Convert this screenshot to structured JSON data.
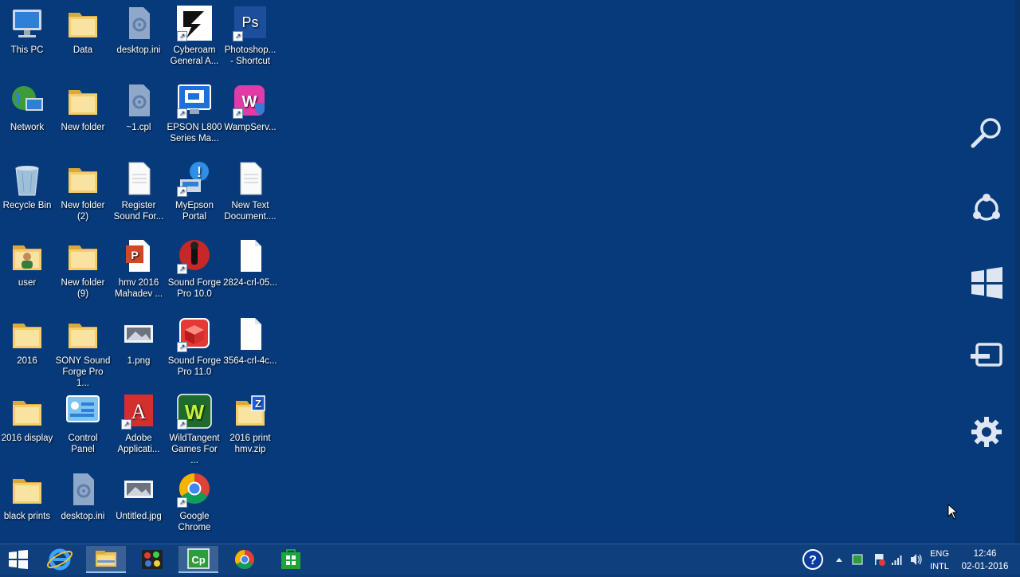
{
  "desktop_icons": [
    {
      "label": "This PC",
      "icon": "computer-icon"
    },
    {
      "label": "Data",
      "icon": "folder-icon"
    },
    {
      "label": "desktop.ini",
      "icon": "settings-file-icon"
    },
    {
      "label": "Cyberoam\nGeneral A...",
      "icon": "cyberoam-icon"
    },
    {
      "label": "Photoshop...\n- Shortcut",
      "icon": "photoshop-icon"
    },
    {
      "label": "Network",
      "icon": "network-icon"
    },
    {
      "label": "New folder",
      "icon": "folder-icon"
    },
    {
      "label": "~1.cpl",
      "icon": "settings-file-icon"
    },
    {
      "label": "EPSON L800\nSeries Ma...",
      "icon": "epson-icon"
    },
    {
      "label": "WampServ...",
      "icon": "wamp-icon"
    },
    {
      "label": "Recycle Bin",
      "icon": "recycle-bin-icon"
    },
    {
      "label": "New folder\n(2)",
      "icon": "folder-icon"
    },
    {
      "label": "Register\nSound For...",
      "icon": "document-icon"
    },
    {
      "label": "MyEpson\nPortal",
      "icon": "myepson-icon"
    },
    {
      "label": "New Text\nDocument....",
      "icon": "text-document-icon"
    },
    {
      "label": "user",
      "icon": "user-folder-icon"
    },
    {
      "label": "New folder\n(9)",
      "icon": "folder-icon"
    },
    {
      "label": "hmv 2016\nMahadev ...",
      "icon": "powerpoint-icon"
    },
    {
      "label": "Sound Forge\nPro 10.0",
      "icon": "sound-forge-icon"
    },
    {
      "label": "2824-crl-05...",
      "icon": "blank-file-icon"
    },
    {
      "label": "2016",
      "icon": "folder-icon"
    },
    {
      "label": "SONY Sound\nForge Pro 1...",
      "icon": "folder-icon"
    },
    {
      "label": "1.png",
      "icon": "image-icon"
    },
    {
      "label": "Sound Forge\nPro 11.0",
      "icon": "sound-forge-11-icon"
    },
    {
      "label": "3564-crl-4c...",
      "icon": "blank-file-icon"
    },
    {
      "label": "2016 display",
      "icon": "folder-icon"
    },
    {
      "label": "Control\nPanel",
      "icon": "control-panel-icon"
    },
    {
      "label": "Adobe\nApplicati...",
      "icon": "adobe-icon"
    },
    {
      "label": "WildTangent\nGames For ...",
      "icon": "wildtangent-icon"
    },
    {
      "label": "2016 print\nhmv.zip",
      "icon": "zip-folder-icon"
    },
    {
      "label": "black prints",
      "icon": "folder-icon"
    },
    {
      "label": "desktop.ini",
      "icon": "settings-file-icon"
    },
    {
      "label": "Untitled.jpg",
      "icon": "image-icon"
    },
    {
      "label": "Google\nChrome",
      "icon": "chrome-icon"
    }
  ],
  "charms": [
    "search-icon",
    "share-icon",
    "start-icon",
    "devices-icon",
    "settings-icon"
  ],
  "taskbar": {
    "apps": [
      "start-button",
      "internet-explorer-icon",
      "file-explorer-icon",
      "paint-icon",
      "camtasia-icon",
      "chrome-icon",
      "store-icon"
    ],
    "lang_top": "ENG",
    "lang_bottom": "INTL",
    "time": "12:46",
    "date": "02-01-2016"
  },
  "colors": {
    "desktop": "#073a7a",
    "taskbar": "#0f3f7c"
  }
}
